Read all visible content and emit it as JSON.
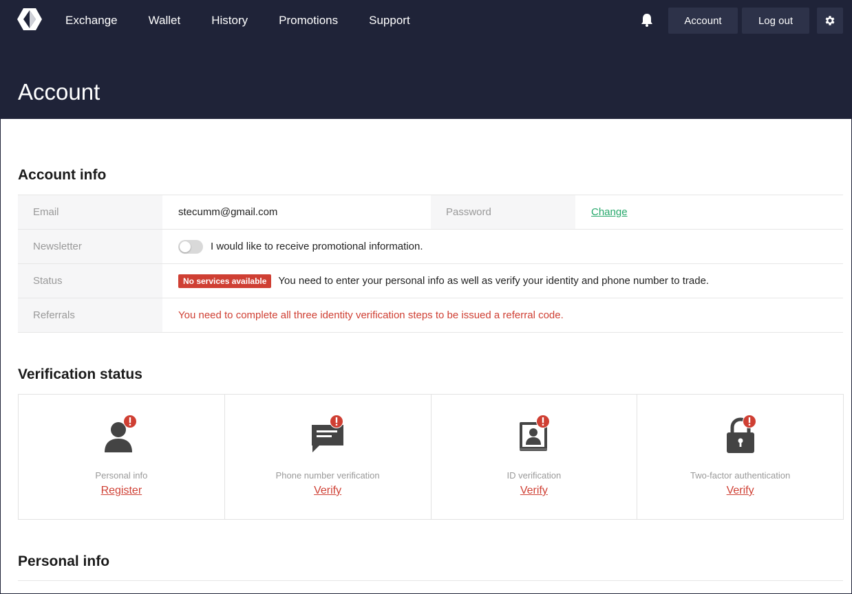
{
  "nav": {
    "items": [
      "Exchange",
      "Wallet",
      "History",
      "Promotions",
      "Support"
    ]
  },
  "header": {
    "account_label": "Account",
    "logout_label": "Log out"
  },
  "page": {
    "title": "Account"
  },
  "account_info": {
    "title": "Account info",
    "email_label": "Email",
    "email_value": "stecumm@gmail.com",
    "password_label": "Password",
    "password_action": "Change",
    "newsletter_label": "Newsletter",
    "newsletter_text": "I would like to receive promotional information.",
    "status_label": "Status",
    "status_badge": "No services available",
    "status_text": "You need to enter your personal info as well as verify your identity and phone number to trade.",
    "referrals_label": "Referrals",
    "referrals_text": "You need to complete all three identity verification steps to be issued a referral code."
  },
  "verification": {
    "title": "Verification status",
    "cards": [
      {
        "caption": "Personal info",
        "action": "Register",
        "icon": "user-icon"
      },
      {
        "caption": "Phone number verification",
        "action": "Verify",
        "icon": "chat-icon"
      },
      {
        "caption": "ID verification",
        "action": "Verify",
        "icon": "id-card-icon"
      },
      {
        "caption": "Two-factor authentication",
        "action": "Verify",
        "icon": "lock-icon"
      }
    ]
  },
  "personal_info": {
    "title": "Personal info"
  },
  "colors": {
    "header_bg": "#1f2338",
    "button_bg": "#2d3249",
    "alert_red": "#cf3f33",
    "link_green": "#26a86b",
    "icon_gray": "#444444"
  }
}
